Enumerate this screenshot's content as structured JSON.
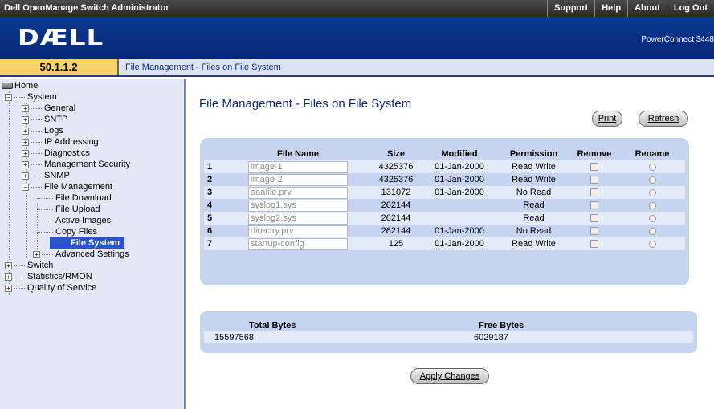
{
  "header": {
    "app_title": "Dell OpenManage Switch Administrator",
    "nav": [
      "Support",
      "Help",
      "About",
      "Log Out"
    ]
  },
  "banner": {
    "logo_text": "DÆLL",
    "product": "PowerConnect 3448"
  },
  "address": {
    "ip": "50.1.1.2",
    "breadcrumb": "File Management - Files on File System"
  },
  "tree": {
    "home": "Home",
    "system": "System",
    "general": "General",
    "sntp": "SNTP",
    "logs": "Logs",
    "ip_addressing": "IP Addressing",
    "diagnostics": "Diagnostics",
    "mgmt_security": "Management Security",
    "snmp": "SNMP",
    "file_management": "File Management",
    "file_download": "File Download",
    "file_upload": "File Upload",
    "active_images": "Active Images",
    "copy_files": "Copy Files",
    "file_system": "File System",
    "advanced_settings": "Advanced Settings",
    "switch": "Switch",
    "statistics": "Statistics/RMON",
    "qos": "Quality of Service"
  },
  "page": {
    "title": "File Management - Files on File System",
    "print_label": "Print",
    "refresh_label": "Refresh",
    "apply_label": "Apply Changes"
  },
  "files_table": {
    "columns": [
      "File Name",
      "Size",
      "Modified",
      "Permission",
      "Remove",
      "Rename"
    ],
    "rows": [
      {
        "n": "1",
        "name": "image-1",
        "size": "4325376",
        "modified": "01-Jan-2000",
        "permission": "Read Write"
      },
      {
        "n": "2",
        "name": "image-2",
        "size": "4325376",
        "modified": "01-Jan-2000",
        "permission": "Read Write"
      },
      {
        "n": "3",
        "name": "aaafile.prv",
        "size": "131072",
        "modified": "01-Jan-2000",
        "permission": "No Read"
      },
      {
        "n": "4",
        "name": "syslog1.sys",
        "size": "262144",
        "modified": "",
        "permission": "Read"
      },
      {
        "n": "5",
        "name": "syslog2.sys",
        "size": "262144",
        "modified": "",
        "permission": "Read"
      },
      {
        "n": "6",
        "name": "directry.prv",
        "size": "262144",
        "modified": "01-Jan-2000",
        "permission": "No Read"
      },
      {
        "n": "7",
        "name": "startup-config",
        "size": "125",
        "modified": "01-Jan-2000",
        "permission": "Read Write"
      }
    ]
  },
  "bytes": {
    "total_label": "Total Bytes",
    "free_label": "Free Bytes",
    "total_value": "15597568",
    "free_value": "6029187"
  }
}
